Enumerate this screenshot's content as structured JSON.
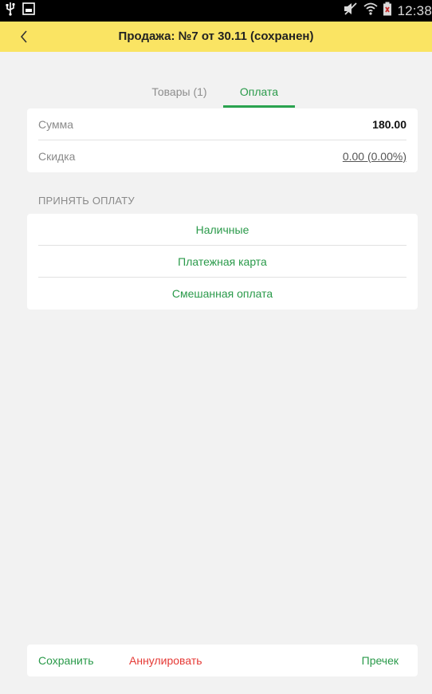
{
  "status_bar": {
    "time": "12:38",
    "icons": [
      "usb-icon",
      "gallery-icon",
      "mute-icon",
      "wifi-icon",
      "battery-icon"
    ]
  },
  "header": {
    "title": "Продажа: №7 от 30.11 (сохранен)"
  },
  "tabs": [
    {
      "label": "Товары (1)",
      "active": false
    },
    {
      "label": "Оплата",
      "active": true
    }
  ],
  "totals": {
    "sum_label": "Сумма",
    "sum_value": "180.00",
    "discount_label": "Скидка",
    "discount_value": "0.00 (0.00%)"
  },
  "payment": {
    "section_title": "ПРИНЯТЬ ОПЛАТУ",
    "options": [
      "Наличные",
      "Платежная карта",
      "Смешанная оплата"
    ]
  },
  "bottom": {
    "save": "Сохранить",
    "cancel": "Аннулировать",
    "precheck": "Пречек"
  },
  "colors": {
    "header_bg": "#fae463",
    "accent_green": "#2a9a4a",
    "danger_red": "#e53935"
  }
}
